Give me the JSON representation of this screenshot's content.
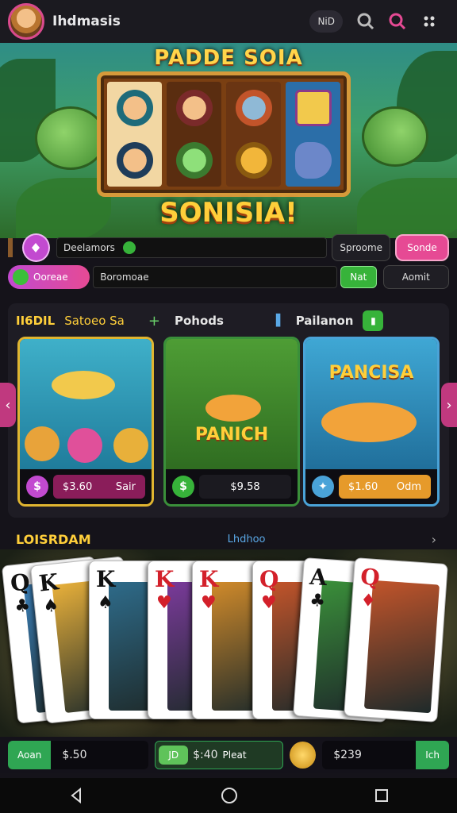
{
  "header": {
    "app_name": "Ihdmasis",
    "chip_label": "NiD"
  },
  "hero": {
    "title": "PADDE SOIA",
    "subtitle": "SONISIA!"
  },
  "controls": {
    "row1": {
      "input_value": "Deelamors",
      "btn_dark": "Sproome",
      "btn_pink": "Sonde"
    },
    "row2": {
      "chip_label": "Ooreae",
      "input_value": "Boromoae",
      "btn_green": "Nat",
      "btn_outline": "Aomit"
    }
  },
  "section2": {
    "tabs": [
      {
        "label": "II6DIL"
      },
      {
        "label": "Satoeo Sa"
      },
      {
        "label": "Pohods"
      },
      {
        "label": "Pailanon"
      }
    ],
    "cards": [
      {
        "foot_price": "$3.60",
        "foot_label": "Sair",
        "caption": ""
      },
      {
        "foot_price": "$9.58",
        "foot_label": "",
        "caption": "PANICH"
      },
      {
        "foot_price": "$1.60",
        "foot_label": "Odm",
        "caption": "PANCISA"
      }
    ]
  },
  "section3": {
    "title": "LOISRDAM",
    "link": "Lhdhoo",
    "cards": [
      {
        "rank": "Q",
        "suit": "♣"
      },
      {
        "rank": "K",
        "suit": "♠"
      },
      {
        "rank": "K",
        "suit": "♠"
      },
      {
        "rank": "K",
        "suit": "♥"
      },
      {
        "rank": "K",
        "suit": "♥"
      },
      {
        "rank": "Q",
        "suit": "♥"
      },
      {
        "rank": "A",
        "suit": "♣"
      },
      {
        "rank": "Q",
        "suit": "♦"
      }
    ]
  },
  "bottom": {
    "g1_btn": "Aoan",
    "g1_val": "$.50",
    "g2_btn": "JD",
    "g2_val": "$:40",
    "g2_label": "Pleat",
    "g3_val": "$239",
    "g3_btn": "Ich"
  },
  "colors": {
    "accent_pink": "#e64a94",
    "accent_green": "#37b33a",
    "gold": "#ffcf3a"
  }
}
